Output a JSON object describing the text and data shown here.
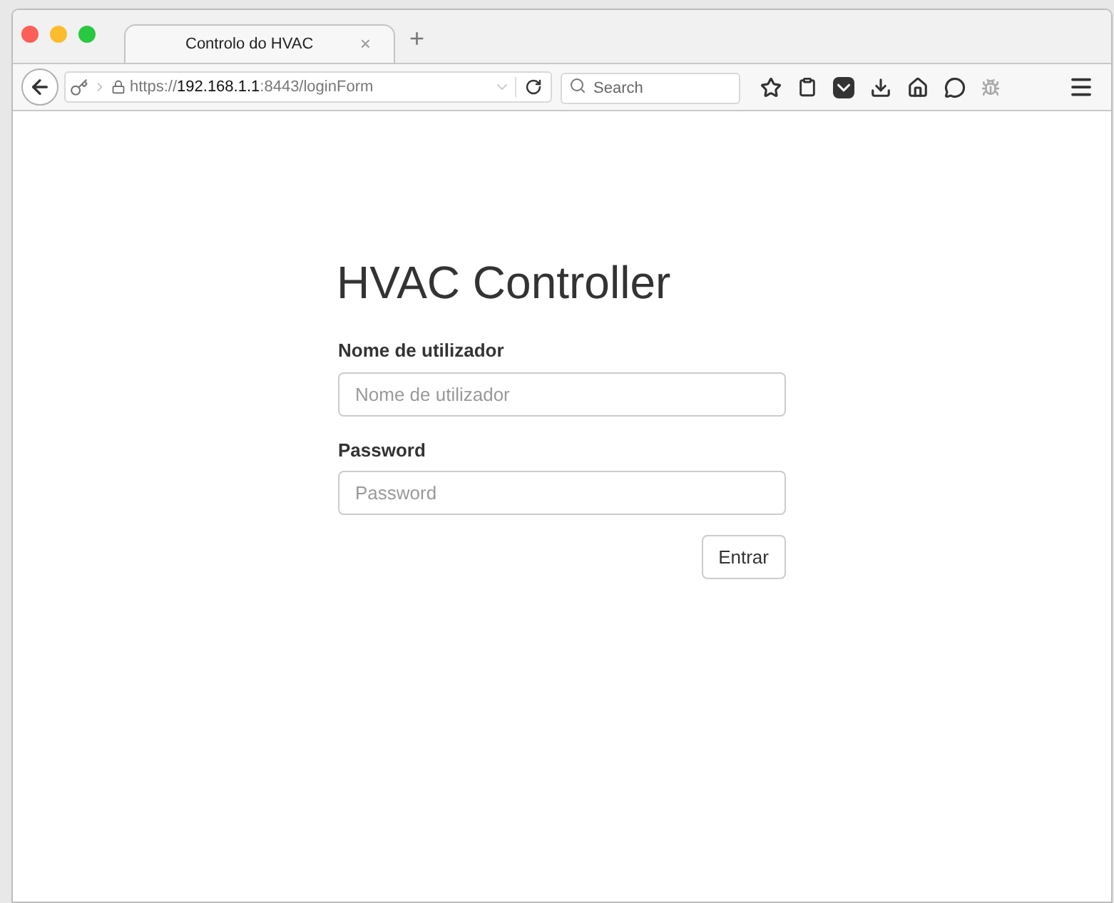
{
  "tab": {
    "title": "Controlo do HVAC",
    "close": "×",
    "selected": true
  },
  "new_tab": "+",
  "address": {
    "scheme": "https://",
    "host": "192.168.1.1",
    "rest": ":8443/loginForm"
  },
  "search": {
    "placeholder": "Search"
  },
  "page": {
    "title": "HVAC Controller",
    "fields": [
      {
        "label": "Nome de utilizador",
        "placeholder": "Nome de utilizador"
      },
      {
        "label": "Password",
        "placeholder": "Password"
      }
    ],
    "submit": "Entrar"
  }
}
